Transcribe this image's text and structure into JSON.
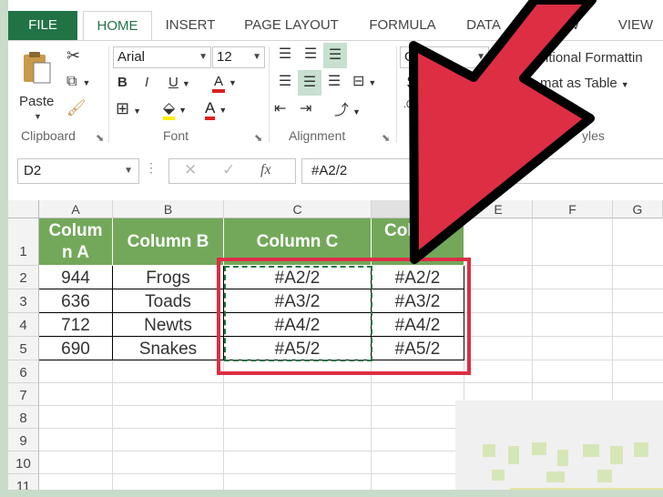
{
  "tabs": {
    "file": "FILE",
    "home": "HOME",
    "insert": "INSERT",
    "page_layout": "PAGE LAYOUT",
    "formulas": "FORMULA",
    "data": "DATA",
    "review": "W",
    "view": "VIEW"
  },
  "ribbon": {
    "paste_label": "Paste",
    "font_name": "Arial",
    "font_size": "12",
    "number_format": "Gen",
    "bold": "B",
    "italic": "I",
    "underline": "U",
    "font_color_glyph": "A",
    "currency": "$",
    "conditional_formatting": "itional Formattin",
    "format_as_table": "mat as Table",
    "groups": {
      "clipboard": "Clipboard",
      "font": "Font",
      "alignment": "Alignment",
      "number": "N",
      "styles": "yles"
    }
  },
  "formula_bar": {
    "name_box": "D2",
    "fx": "fx",
    "formula": "#A2/2"
  },
  "grid": {
    "columns": [
      "A",
      "B",
      "C",
      "D",
      "E",
      "F",
      "G"
    ],
    "rows": [
      "1",
      "2",
      "3",
      "4",
      "5",
      "6",
      "7",
      "8",
      "9",
      "10",
      "11"
    ],
    "header_row": {
      "a_line1": "Colum",
      "a_line2": "n A",
      "b": "Column B",
      "c": "Column C",
      "d": "Col"
    },
    "data": [
      {
        "a": "944",
        "b": "Frogs",
        "c": "#A2/2",
        "d": "#A2/2"
      },
      {
        "a": "636",
        "b": "Toads",
        "c": "#A3/2",
        "d": "#A3/2"
      },
      {
        "a": "712",
        "b": "Newts",
        "c": "#A4/2",
        "d": "#A4/2"
      },
      {
        "a": "690",
        "b": "Snakes",
        "c": "#A5/2",
        "d": "#A5/2"
      }
    ]
  },
  "colors": {
    "accent": "#217346",
    "header_fill": "#73a85a",
    "annotation_red": "#dd2e44"
  }
}
